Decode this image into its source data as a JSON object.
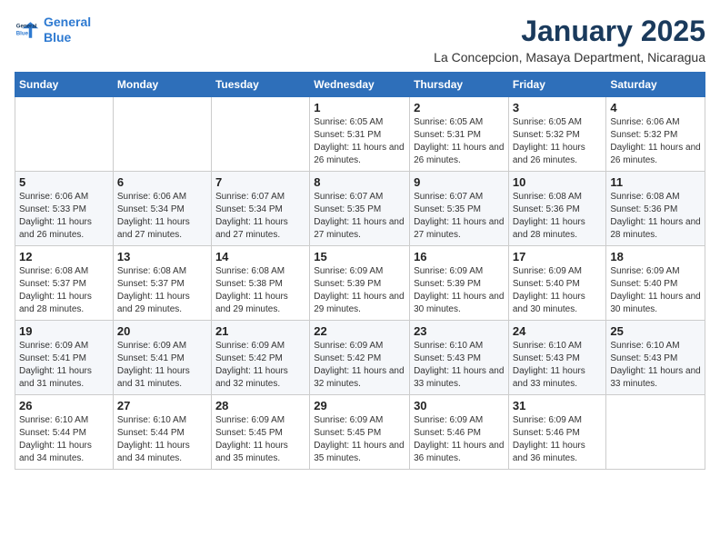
{
  "logo": {
    "line1": "General",
    "line2": "Blue"
  },
  "title": "January 2025",
  "location": "La Concepcion, Masaya Department, Nicaragua",
  "header_row": [
    "Sunday",
    "Monday",
    "Tuesday",
    "Wednesday",
    "Thursday",
    "Friday",
    "Saturday"
  ],
  "weeks": [
    [
      {
        "day": "",
        "info": ""
      },
      {
        "day": "",
        "info": ""
      },
      {
        "day": "",
        "info": ""
      },
      {
        "day": "1",
        "info": "Sunrise: 6:05 AM\nSunset: 5:31 PM\nDaylight: 11 hours and 26 minutes."
      },
      {
        "day": "2",
        "info": "Sunrise: 6:05 AM\nSunset: 5:31 PM\nDaylight: 11 hours and 26 minutes."
      },
      {
        "day": "3",
        "info": "Sunrise: 6:05 AM\nSunset: 5:32 PM\nDaylight: 11 hours and 26 minutes."
      },
      {
        "day": "4",
        "info": "Sunrise: 6:06 AM\nSunset: 5:32 PM\nDaylight: 11 hours and 26 minutes."
      }
    ],
    [
      {
        "day": "5",
        "info": "Sunrise: 6:06 AM\nSunset: 5:33 PM\nDaylight: 11 hours and 26 minutes."
      },
      {
        "day": "6",
        "info": "Sunrise: 6:06 AM\nSunset: 5:34 PM\nDaylight: 11 hours and 27 minutes."
      },
      {
        "day": "7",
        "info": "Sunrise: 6:07 AM\nSunset: 5:34 PM\nDaylight: 11 hours and 27 minutes."
      },
      {
        "day": "8",
        "info": "Sunrise: 6:07 AM\nSunset: 5:35 PM\nDaylight: 11 hours and 27 minutes."
      },
      {
        "day": "9",
        "info": "Sunrise: 6:07 AM\nSunset: 5:35 PM\nDaylight: 11 hours and 27 minutes."
      },
      {
        "day": "10",
        "info": "Sunrise: 6:08 AM\nSunset: 5:36 PM\nDaylight: 11 hours and 28 minutes."
      },
      {
        "day": "11",
        "info": "Sunrise: 6:08 AM\nSunset: 5:36 PM\nDaylight: 11 hours and 28 minutes."
      }
    ],
    [
      {
        "day": "12",
        "info": "Sunrise: 6:08 AM\nSunset: 5:37 PM\nDaylight: 11 hours and 28 minutes."
      },
      {
        "day": "13",
        "info": "Sunrise: 6:08 AM\nSunset: 5:37 PM\nDaylight: 11 hours and 29 minutes."
      },
      {
        "day": "14",
        "info": "Sunrise: 6:08 AM\nSunset: 5:38 PM\nDaylight: 11 hours and 29 minutes."
      },
      {
        "day": "15",
        "info": "Sunrise: 6:09 AM\nSunset: 5:39 PM\nDaylight: 11 hours and 29 minutes."
      },
      {
        "day": "16",
        "info": "Sunrise: 6:09 AM\nSunset: 5:39 PM\nDaylight: 11 hours and 30 minutes."
      },
      {
        "day": "17",
        "info": "Sunrise: 6:09 AM\nSunset: 5:40 PM\nDaylight: 11 hours and 30 minutes."
      },
      {
        "day": "18",
        "info": "Sunrise: 6:09 AM\nSunset: 5:40 PM\nDaylight: 11 hours and 30 minutes."
      }
    ],
    [
      {
        "day": "19",
        "info": "Sunrise: 6:09 AM\nSunset: 5:41 PM\nDaylight: 11 hours and 31 minutes."
      },
      {
        "day": "20",
        "info": "Sunrise: 6:09 AM\nSunset: 5:41 PM\nDaylight: 11 hours and 31 minutes."
      },
      {
        "day": "21",
        "info": "Sunrise: 6:09 AM\nSunset: 5:42 PM\nDaylight: 11 hours and 32 minutes."
      },
      {
        "day": "22",
        "info": "Sunrise: 6:09 AM\nSunset: 5:42 PM\nDaylight: 11 hours and 32 minutes."
      },
      {
        "day": "23",
        "info": "Sunrise: 6:10 AM\nSunset: 5:43 PM\nDaylight: 11 hours and 33 minutes."
      },
      {
        "day": "24",
        "info": "Sunrise: 6:10 AM\nSunset: 5:43 PM\nDaylight: 11 hours and 33 minutes."
      },
      {
        "day": "25",
        "info": "Sunrise: 6:10 AM\nSunset: 5:43 PM\nDaylight: 11 hours and 33 minutes."
      }
    ],
    [
      {
        "day": "26",
        "info": "Sunrise: 6:10 AM\nSunset: 5:44 PM\nDaylight: 11 hours and 34 minutes."
      },
      {
        "day": "27",
        "info": "Sunrise: 6:10 AM\nSunset: 5:44 PM\nDaylight: 11 hours and 34 minutes."
      },
      {
        "day": "28",
        "info": "Sunrise: 6:09 AM\nSunset: 5:45 PM\nDaylight: 11 hours and 35 minutes."
      },
      {
        "day": "29",
        "info": "Sunrise: 6:09 AM\nSunset: 5:45 PM\nDaylight: 11 hours and 35 minutes."
      },
      {
        "day": "30",
        "info": "Sunrise: 6:09 AM\nSunset: 5:46 PM\nDaylight: 11 hours and 36 minutes."
      },
      {
        "day": "31",
        "info": "Sunrise: 6:09 AM\nSunset: 5:46 PM\nDaylight: 11 hours and 36 minutes."
      },
      {
        "day": "",
        "info": ""
      }
    ]
  ]
}
